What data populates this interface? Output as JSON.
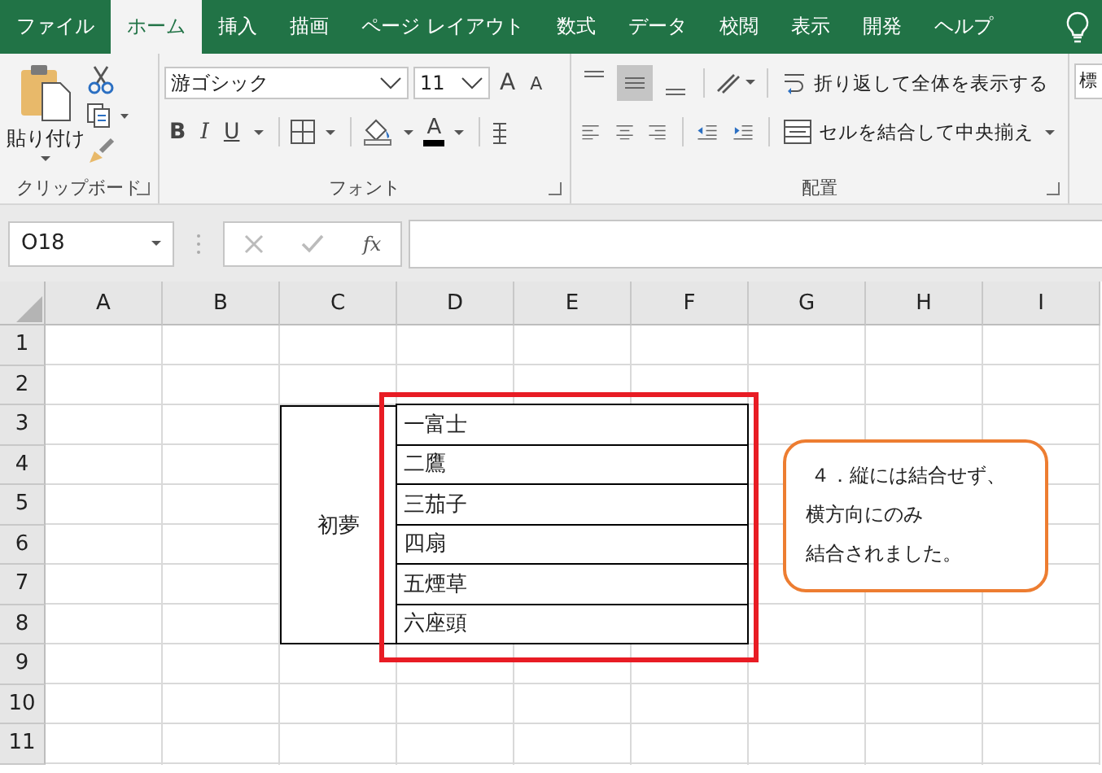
{
  "tabs": [
    {
      "label": "ファイル",
      "selected": false
    },
    {
      "label": "ホーム",
      "selected": true
    },
    {
      "label": "挿入",
      "selected": false
    },
    {
      "label": "描画",
      "selected": false
    },
    {
      "label": "ページ レイアウト",
      "selected": false
    },
    {
      "label": "数式",
      "selected": false
    },
    {
      "label": "データ",
      "selected": false
    },
    {
      "label": "校閲",
      "selected": false
    },
    {
      "label": "表示",
      "selected": false
    },
    {
      "label": "開発",
      "selected": false
    },
    {
      "label": "ヘルプ",
      "selected": false
    }
  ],
  "ribbon": {
    "clipboard": {
      "paste_label": "貼り付け",
      "group_label": "クリップボード"
    },
    "font": {
      "font_name": "游ゴシック",
      "font_size": "11",
      "grow_glyph": "A",
      "shrink_glyph": "A",
      "style_buttons": [
        "B",
        "I",
        "U"
      ],
      "color_glyph": "A",
      "group_label": "フォント"
    },
    "alignment": {
      "vertical": [
        {
          "selected": false
        },
        {
          "selected": true
        },
        {
          "selected": false
        }
      ],
      "wrap_text": "折り返して全体を表示する",
      "merge_center": "セルを結合して中央揃え",
      "group_label": "配置"
    },
    "number_format": "標"
  },
  "name_box": "O18",
  "fx": "fx",
  "columns": [
    "A",
    "B",
    "C",
    "D",
    "E",
    "F",
    "G",
    "H",
    "I"
  ],
  "rows": [
    "1",
    "2",
    "3",
    "4",
    "5",
    "6",
    "7",
    "8",
    "9",
    "10",
    "11"
  ],
  "table": {
    "label": "初夢",
    "items": [
      "一富士",
      "二鷹",
      "三茄子",
      "四扇",
      "五煙草",
      "六座頭"
    ]
  },
  "callout": {
    "lines": [
      "４．縦には結合せず、",
      "横方向にのみ",
      "結合されました。"
    ]
  }
}
